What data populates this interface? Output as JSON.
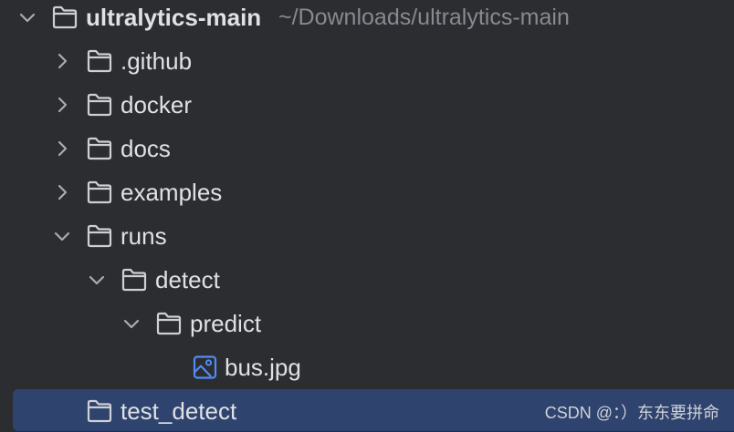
{
  "project_tree": {
    "root": {
      "name": "ultralytics-main",
      "path": "~/Downloads/ultralytics-main"
    },
    "items": [
      {
        "name": ".github",
        "type": "folder",
        "state": "collapsed"
      },
      {
        "name": "docker",
        "type": "folder",
        "state": "collapsed"
      },
      {
        "name": "docs",
        "type": "folder",
        "state": "collapsed"
      },
      {
        "name": "examples",
        "type": "folder",
        "state": "collapsed"
      },
      {
        "name": "runs",
        "type": "folder",
        "state": "expanded"
      },
      {
        "name": "detect",
        "type": "folder",
        "state": "expanded"
      },
      {
        "name": "predict",
        "type": "folder",
        "state": "expanded"
      },
      {
        "name": "bus.jpg",
        "type": "image-file"
      },
      {
        "name": "test_detect",
        "type": "folder",
        "selected": true
      }
    ]
  },
  "watermark": "CSDN @：）东东要拼命",
  "colors": {
    "background": "#2b2d30",
    "selection": "#2e436e",
    "text": "#dfe1e5",
    "path_text": "#868a91",
    "image_icon": "#548af7"
  },
  "icons": {
    "expanded": "chevron-down-icon",
    "collapsed": "chevron-right-icon",
    "folder": "folder-icon",
    "image": "image-file-icon"
  }
}
